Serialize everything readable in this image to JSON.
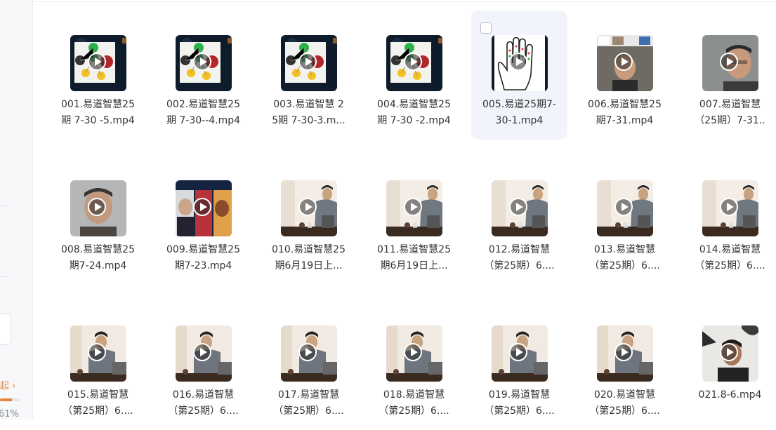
{
  "sidebar": {
    "collapse_label": "起 ›",
    "storage_percent": "61%",
    "storage_fraction": 0.61
  },
  "files": [
    {
      "line1": "001.易道智慧25",
      "line2": "期 7-30 -5.mp4",
      "thumb": "diagram"
    },
    {
      "line1": "002.易道智慧25",
      "line2": "期 7-30--4.mp4",
      "thumb": "diagram"
    },
    {
      "line1": "003.易道智慧 2",
      "line2": "5期 7-30-3.m...",
      "thumb": "diagram"
    },
    {
      "line1": "004.易道智慧25",
      "line2": "期 7-30 -2.mp4",
      "thumb": "diagram"
    },
    {
      "line1": "005.易道25期7-",
      "line2": "30-1.mp4",
      "thumb": "hand"
    },
    {
      "line1": "006.易道智慧25",
      "line2": "期7-31.mp4",
      "thumb": "videocall"
    },
    {
      "line1": "007.易道智慧",
      "line2": "（25期）7-31..",
      "thumb": "face"
    },
    {
      "line1": "008.易道智慧25",
      "line2": "期7-24.mp4",
      "thumb": "face-blur"
    },
    {
      "line1": "009.易道智慧25",
      "line2": "期7-23.mp4",
      "thumb": "collage"
    },
    {
      "line1": "010.易道智慧25",
      "line2": "期6月19日上...",
      "thumb": "studio"
    },
    {
      "line1": "011.易道智慧25",
      "line2": "期6月19日上...",
      "thumb": "studio"
    },
    {
      "line1": "012.易道智慧",
      "line2": "（第25期）6....",
      "thumb": "studio"
    },
    {
      "line1": "013.易道智慧",
      "line2": "（第25期）6....",
      "thumb": "studio"
    },
    {
      "line1": "014.易道智慧",
      "line2": "（第25期）6....",
      "thumb": "studio"
    },
    {
      "line1": "015.易道智慧",
      "line2": "（第25期）6....",
      "thumb": "studio2"
    },
    {
      "line1": "016.易道智慧",
      "line2": "（第25期）6....",
      "thumb": "studio2"
    },
    {
      "line1": "017.易道智慧",
      "line2": "（第25期）6....",
      "thumb": "studio2"
    },
    {
      "line1": "018.易道智慧",
      "line2": "（第25期）6....",
      "thumb": "studio2"
    },
    {
      "line1": "019.易道智慧",
      "line2": "（第25期）6....",
      "thumb": "studio2"
    },
    {
      "line1": "020.易道智慧",
      "line2": "（第25期）6....",
      "thumb": "studio2"
    },
    {
      "line1": "021.8-6.mp4",
      "line2": "",
      "thumb": "selfie"
    }
  ],
  "selected_index": 4,
  "colors": {
    "accent": "#e8833a",
    "selected_bg": "#f1f4fa",
    "diagram_bg": "#0e1b2a"
  },
  "icons": {
    "play": "play-icon",
    "checkbox": "checkbox-icon"
  }
}
